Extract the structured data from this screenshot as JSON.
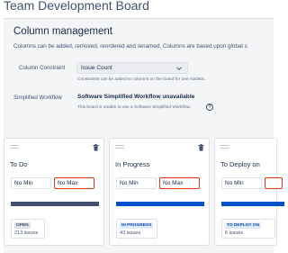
{
  "header": {
    "board_title": "Team Development Board"
  },
  "column_management": {
    "title": "Column management",
    "description": "Columns can be added, removed, reordered and renamed. Columns are based upon global s"
  },
  "column_constraint": {
    "label": "Column Constraint",
    "value": "Issue Count",
    "hint": "Constraints can be added to columns on the board for one statistic."
  },
  "simplified_workflow": {
    "label": "Simplified Workflow",
    "value": "Software Simplified Workflow unavailable",
    "hint": "This board is unable to use a Software Simplified Workflow."
  },
  "colors": {
    "todo_bar": "#42526e",
    "progress_bar": "#0052cc",
    "accent_red": "#de350b",
    "panel_bg": "#f4f5f7"
  },
  "columns": [
    {
      "name": "To Do",
      "min_placeholder": "No Min",
      "max_placeholder": "No Max",
      "status": "OPEN",
      "issue_count": "213 issues"
    },
    {
      "name": "In Progress",
      "min_placeholder": "No Min",
      "max_placeholder": "No Max",
      "status": "IN PROGRESS",
      "issue_count": "43 issues"
    },
    {
      "name": "To Deploy on",
      "min_placeholder": "No Min",
      "max_placeholder": "",
      "status": "TO DEPLOY ON",
      "issue_count": "6 issues"
    }
  ]
}
